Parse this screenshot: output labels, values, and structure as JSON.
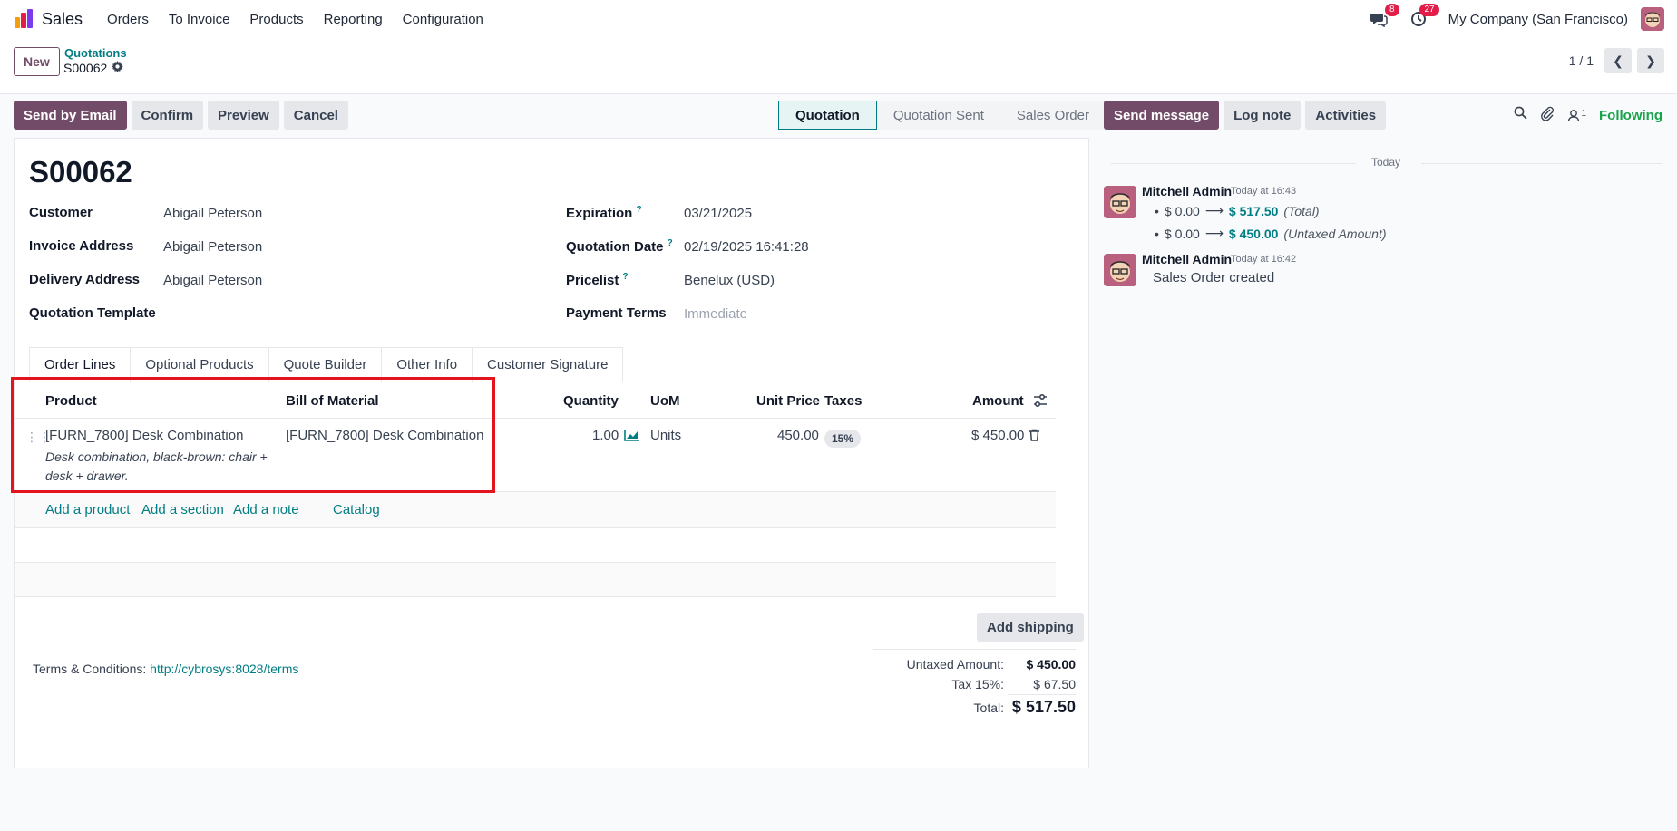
{
  "app": {
    "name": "Sales"
  },
  "menu": [
    "Orders",
    "To Invoice",
    "Products",
    "Reporting",
    "Configuration"
  ],
  "systray": {
    "messages_count": "8",
    "activities_count": "27",
    "company": "My Company (San Francisco)"
  },
  "control": {
    "new_label": "New",
    "breadcrumb": "Quotations",
    "record": "S00062",
    "pager": "1 / 1"
  },
  "actions": {
    "send_email": "Send by Email",
    "confirm": "Confirm",
    "preview": "Preview",
    "cancel": "Cancel"
  },
  "status": {
    "stages": [
      "Quotation",
      "Quotation Sent",
      "Sales Order"
    ],
    "active": "Quotation"
  },
  "record": {
    "title": "S00062",
    "fields_left": [
      {
        "label": "Customer",
        "value": "Abigail Peterson"
      },
      {
        "label": "Invoice Address",
        "value": "Abigail Peterson"
      },
      {
        "label": "Delivery Address",
        "value": "Abigail Peterson"
      },
      {
        "label": "Quotation Template",
        "value": ""
      }
    ],
    "fields_right": [
      {
        "label": "Expiration",
        "help": "?",
        "value": "03/21/2025"
      },
      {
        "label": "Quotation Date",
        "help": "?",
        "value": "02/19/2025 16:41:28"
      },
      {
        "label": "Pricelist",
        "help": "?",
        "value": "Benelux (USD)"
      },
      {
        "label": "Payment Terms",
        "help": "",
        "value": "Immediate"
      }
    ]
  },
  "tabs": [
    "Order Lines",
    "Optional Products",
    "Quote Builder",
    "Other Info",
    "Customer Signature"
  ],
  "table": {
    "headers": {
      "product": "Product",
      "bom": "Bill of Material",
      "quantity": "Quantity",
      "uom": "UoM",
      "unit_price": "Unit Price",
      "taxes": "Taxes",
      "amount": "Amount"
    },
    "line": {
      "product": "[FURN_7800] Desk Combination",
      "description": "Desk combination, black-brown: chair + desk + drawer.",
      "bom": "[FURN_7800] Desk Combination",
      "quantity": "1.00",
      "uom": "Units",
      "unit_price": "450.00",
      "tax": "15%",
      "amount": "$ 450.00"
    },
    "add_links": [
      "Add a product",
      "Add a section",
      "Add a note",
      "Catalog"
    ]
  },
  "footer": {
    "add_shipping": "Add shipping",
    "terms_label": "Terms & Conditions:",
    "terms_link": "http://cybrosys:8028/terms",
    "untaxed_label": "Untaxed Amount:",
    "untaxed_value": "$ 450.00",
    "tax_label": "Tax 15%:",
    "tax_value": "$ 67.50",
    "total_label": "Total:",
    "total_value": "$ 517.50"
  },
  "chatter": {
    "send_message": "Send message",
    "log_note": "Log note",
    "activities": "Activities",
    "followers_count": "1",
    "following": "Following",
    "today": "Today",
    "messages": [
      {
        "author": "Mitchell Admin",
        "time": "Today at 16:43",
        "tracking": [
          {
            "old": "$ 0.00",
            "new": "$ 517.50",
            "field": "(Total)"
          },
          {
            "old": "$ 0.00",
            "new": "$ 450.00",
            "field": "(Untaxed Amount)"
          }
        ]
      },
      {
        "author": "Mitchell Admin",
        "time": "Today at 16:42",
        "body": "Sales Order created"
      }
    ]
  },
  "colors": {
    "brand": "#714b67",
    "link": "#017e84",
    "highlight": "#e3141e",
    "following": "#16a34a"
  }
}
